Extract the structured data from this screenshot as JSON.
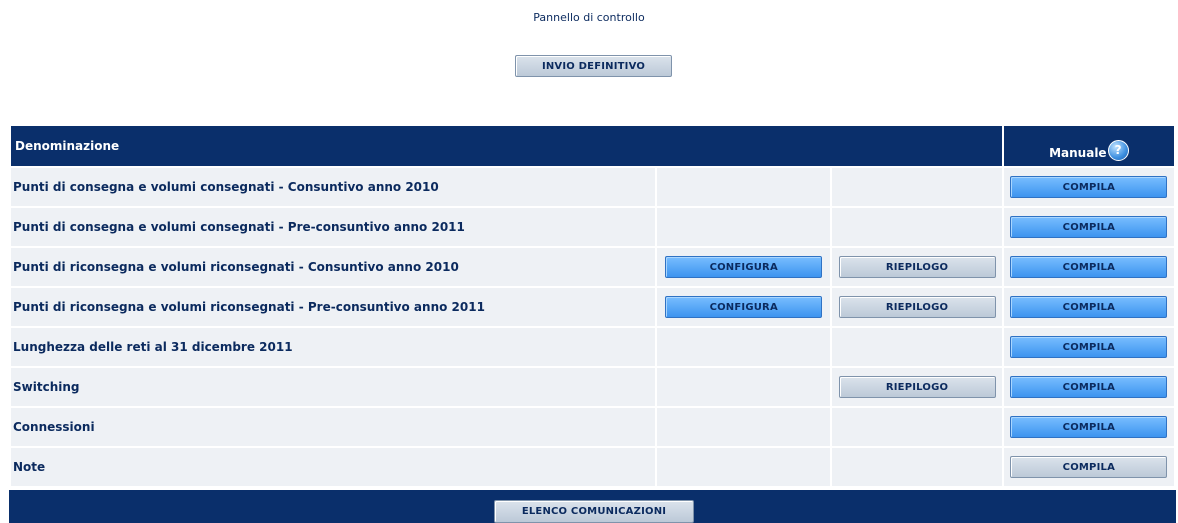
{
  "page": {
    "title": "Pannello di controllo"
  },
  "top_button": {
    "label": "INVIO DEFINITIVO"
  },
  "table": {
    "header": {
      "denominazione": "Denominazione",
      "manuale": "Manuale",
      "help_icon": "?"
    },
    "rows": [
      {
        "label": "Punti di consegna e volumi consegnati - Consuntivo anno 2010",
        "compila": "COMPILA"
      },
      {
        "label": "Punti di consegna e volumi consegnati - Pre-consuntivo anno 2011",
        "compila": "COMPILA"
      },
      {
        "label": "Punti di riconsegna e volumi riconsegnati - Consuntivo anno 2010",
        "configura": "CONFIGURA",
        "riepilogo": "RIEPILOGO",
        "compila": "COMPILA"
      },
      {
        "label": "Punti di riconsegna e volumi riconsegnati - Pre-consuntivo anno 2011",
        "configura": "CONFIGURA",
        "riepilogo": "RIEPILOGO",
        "compila": "COMPILA"
      },
      {
        "label": "Lunghezza delle reti al 31 dicembre 2011",
        "compila": "COMPILA"
      },
      {
        "label": "Switching",
        "riepilogo": "RIEPILOGO",
        "compila": "COMPILA"
      },
      {
        "label": "Connessioni",
        "compila": "COMPILA"
      },
      {
        "label": "Note",
        "compila": "COMPILA",
        "compila_style": "gray"
      }
    ]
  },
  "footer": {
    "button_label": "ELENCO COMUNICAZIONI"
  },
  "colors": {
    "header_bg": "#0a2f6b",
    "row_bg": "#eef1f5",
    "text": "#0b2a5e",
    "button_blue": "#4fa3f7",
    "button_gray": "#c9d3df"
  }
}
